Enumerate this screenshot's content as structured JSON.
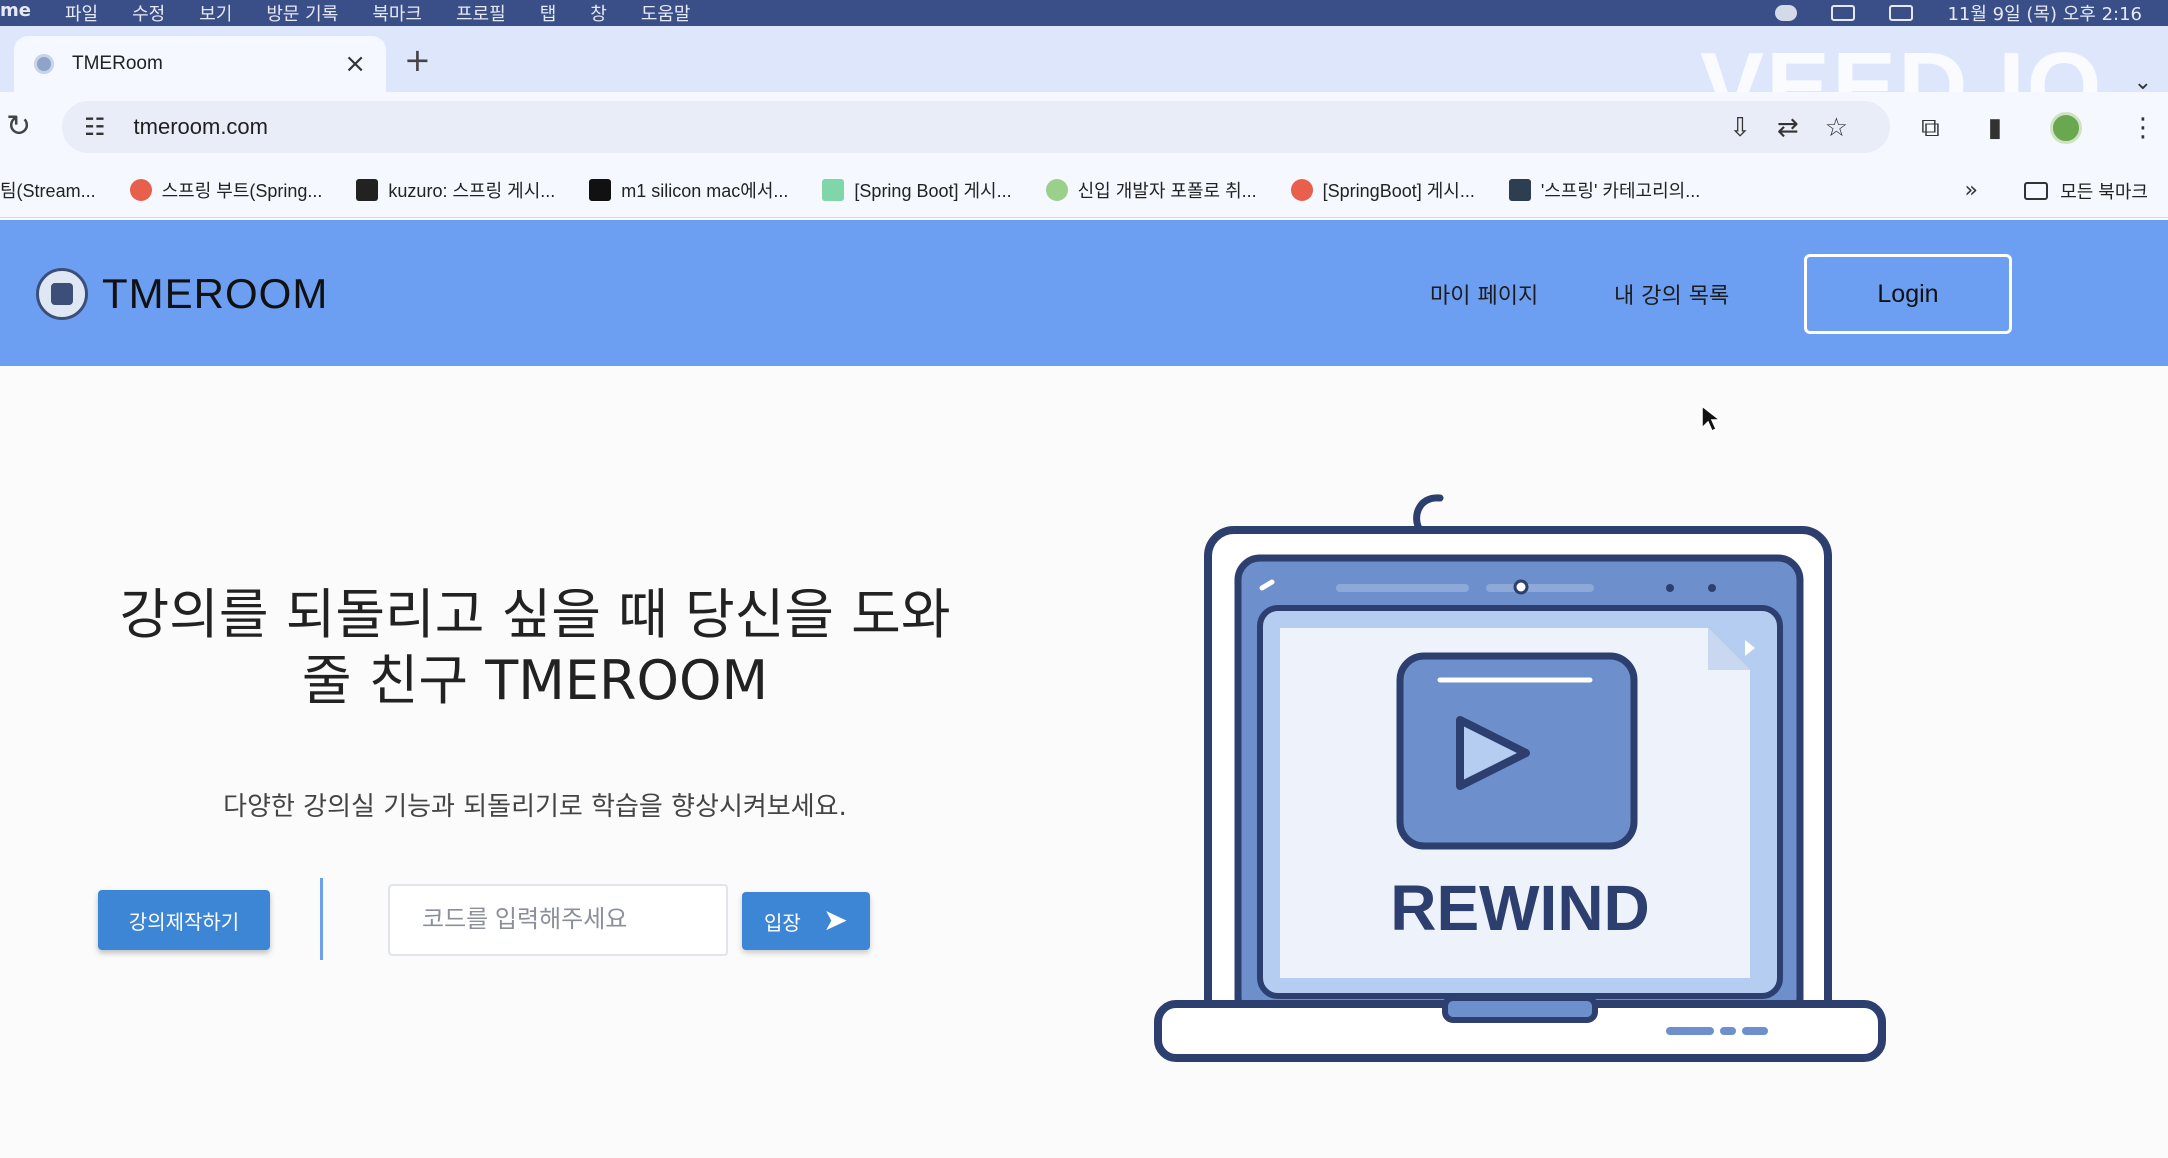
{
  "mac_menu": {
    "items": [
      "me",
      "파일",
      "수정",
      "보기",
      "방문 기록",
      "북마크",
      "프로필",
      "탭",
      "창",
      "도움말"
    ],
    "clock": "11월 9일 (목) 오후 2:16"
  },
  "browser": {
    "tab_title": "TMERoom",
    "close_glyph": "×",
    "new_tab_glyph": "+",
    "url": "tmeroom.com",
    "watermark": "VEED.IO",
    "bookmarks": [
      {
        "label": "팀(Stream...",
        "color": "#ffffff"
      },
      {
        "label": "스프링 부트(Spring...",
        "color": "#e8604c"
      },
      {
        "label": "kuzuro: 스프링 게시...",
        "color": "#222222"
      },
      {
        "label": "m1 silicon mac에서...",
        "color": "#111111"
      },
      {
        "label": "[Spring Boot] 게시...",
        "color": "#7fd6a8"
      },
      {
        "label": "신입 개발자 포폴로 취...",
        "color": "#9bd08a"
      },
      {
        "label": "[SpringBoot] 게시...",
        "color": "#e8604c"
      },
      {
        "label": "'스프링' 카테고리의...",
        "color": "#2c3e50"
      }
    ],
    "more_glyph": "»",
    "all_bookmarks": "모든 북마크"
  },
  "header": {
    "logo_text": "TMEROOM",
    "nav": {
      "my_page": "마이 페이지",
      "my_lectures": "내 강의 목록"
    },
    "login": "Login",
    "color": "#6c9ef1"
  },
  "hero": {
    "title_line1": "강의를 되돌리고 싶을 때 당신을 도와",
    "title_line2": "줄 친구 TMEROOM",
    "subtitle": "다양한 강의실 기능과 되돌리기로 학습을 향상시켜보세요.",
    "create_button": "강의제작하기",
    "code_placeholder": "코드를 입력해주세요",
    "enter_button": "입장",
    "enter_icon": "➤",
    "illustration_text": "REWIND",
    "accent": "#3d86d6"
  }
}
